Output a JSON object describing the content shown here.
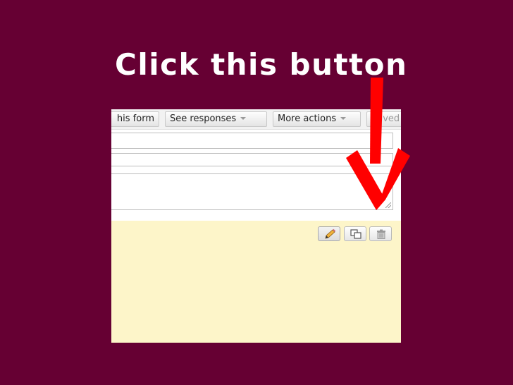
{
  "colors": {
    "background": "#660033",
    "title": "#ffffff",
    "arrow": "#ff0000",
    "panel": "#fdf5c9"
  },
  "slide": {
    "title": "Click this button"
  },
  "toolbar": {
    "form_label": "his form",
    "responses_label": "See responses",
    "more_actions_label": "More actions",
    "saved_label": "Saved"
  },
  "question_actions": {
    "edit_icon": "pencil-icon",
    "duplicate_icon": "duplicate-icon",
    "delete_icon": "trash-icon"
  }
}
